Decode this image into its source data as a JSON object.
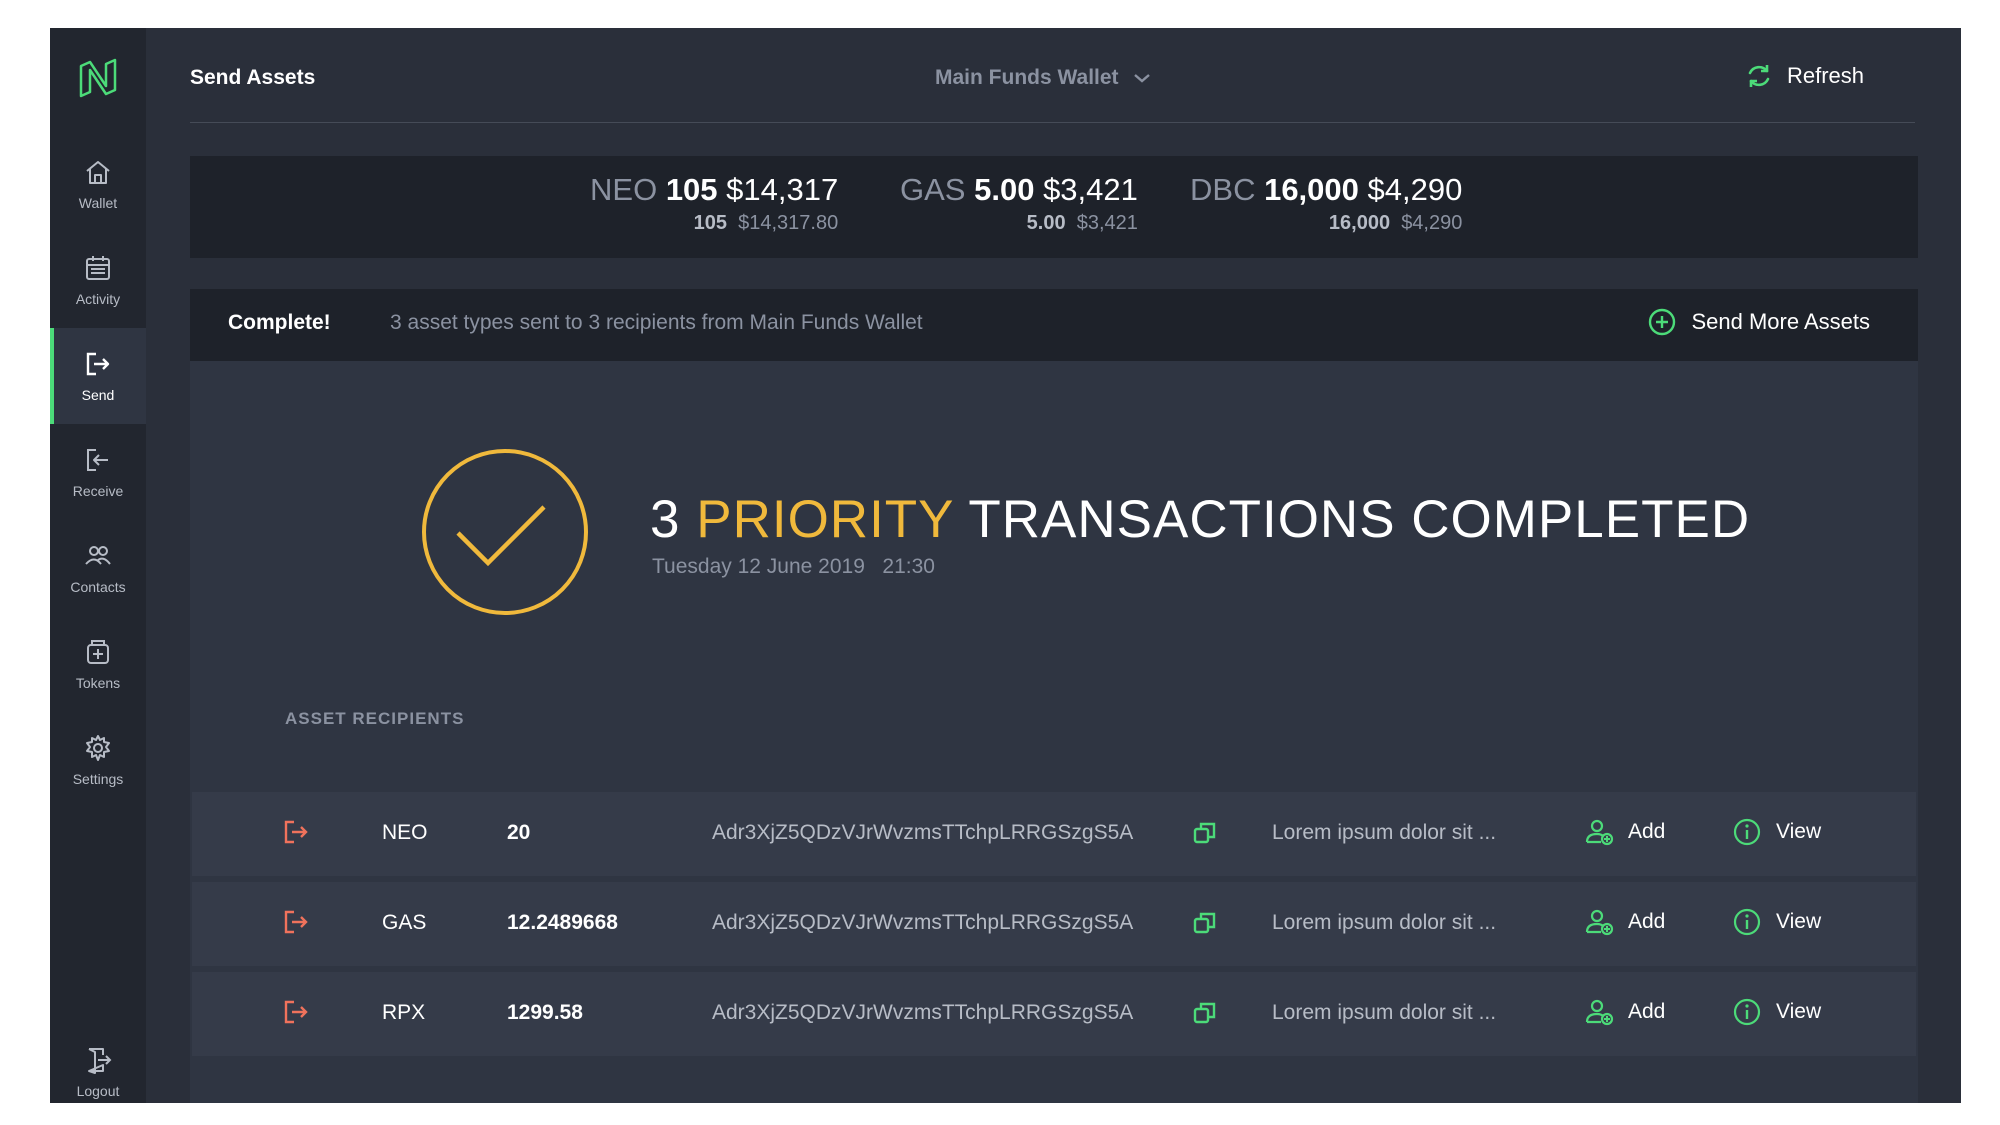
{
  "sidebar": {
    "logo": "neon-logo-icon",
    "items": [
      {
        "label": "Wallet",
        "icon": "home-icon"
      },
      {
        "label": "Activity",
        "icon": "calendar-icon"
      },
      {
        "label": "Send",
        "icon": "send-icon",
        "active": true
      },
      {
        "label": "Receive",
        "icon": "receive-icon"
      },
      {
        "label": "Contacts",
        "icon": "contacts-icon"
      },
      {
        "label": "Tokens",
        "icon": "tokens-icon"
      },
      {
        "label": "Settings",
        "icon": "gear-icon"
      }
    ],
    "logout": {
      "label": "Logout",
      "icon": "logout-icon"
    }
  },
  "header": {
    "title": "Send Assets",
    "wallet": "Main Funds Wallet",
    "refresh_label": "Refresh"
  },
  "balances": [
    {
      "symbol": "NEO",
      "amount": "105",
      "value": "$14,317",
      "sub_amount": "105",
      "sub_value": "$14,317.80"
    },
    {
      "symbol": "GAS",
      "amount": "5.00",
      "value": "$3,421",
      "sub_amount": "5.00",
      "sub_value": "$3,421"
    },
    {
      "symbol": "DBC",
      "amount": "16,000",
      "value": "$4,290",
      "sub_amount": "16,000",
      "sub_value": "$4,290"
    }
  ],
  "status": {
    "label": "Complete!",
    "message": "3 asset types sent to 3 recipients from Main Funds Wallet",
    "action": "Send More Assets"
  },
  "result": {
    "count": "3",
    "priority": "PRIORITY",
    "rest": "TRANSACTIONS COMPLETED",
    "date": "Tuesday 12 June 2019",
    "time": "21:30"
  },
  "recipients": {
    "title": "ASSET RECIPIENTS",
    "add_label": "Add",
    "view_label": "View",
    "rows": [
      {
        "asset": "NEO",
        "amount": "20",
        "address": "Adr3XjZ5QDzVJrWvzmsTTchpLRRGSzgS5A",
        "note": "Lorem ipsum dolor sit ..."
      },
      {
        "asset": "GAS",
        "amount": "12.2489668",
        "address": "Adr3XjZ5QDzVJrWvzmsTTchpLRRGSzgS5A",
        "note": "Lorem ipsum dolor sit ..."
      },
      {
        "asset": "RPX",
        "amount": "1299.58",
        "address": "Adr3XjZ5QDzVJrWvzmsTTchpLRRGSzgS5A",
        "note": "Lorem ipsum dolor sit ..."
      }
    ]
  },
  "colors": {
    "accent_green": "#4cdb79",
    "priority_yellow": "#f0b93c",
    "send_red": "#f0725c"
  }
}
